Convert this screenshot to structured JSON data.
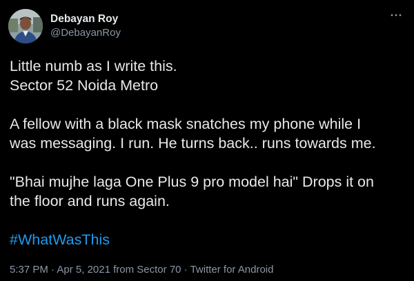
{
  "tweet": {
    "display_name": "Debayan Roy",
    "handle": "@DebayanRoy",
    "line1": "Little numb as I write this.",
    "line2": "Sector 52 Noida Metro",
    "para2_line1": "A fellow with a black mask snatches my phone while I",
    "para2_line2": "was messaging. I run. He turns back.. runs towards me.",
    "para3_line1": "\"Bhai mujhe laga One Plus 9 pro model hai\" Drops it on",
    "para3_line2": "the floor and runs again.",
    "hashtag": "#WhatWasThis",
    "time": "5:37 PM",
    "dot1": " · ",
    "date": "Apr 5, 2021",
    "from_text": " from ",
    "location": "Sector 70",
    "dot2": " · ",
    "source": "Twitter for Android"
  },
  "icons": {
    "more": "more-dots-icon",
    "avatar": "user-avatar"
  },
  "colors": {
    "background": "#000000",
    "text": "#e7e9ea",
    "secondary": "#8b98a5",
    "link": "#1d9bf0"
  }
}
